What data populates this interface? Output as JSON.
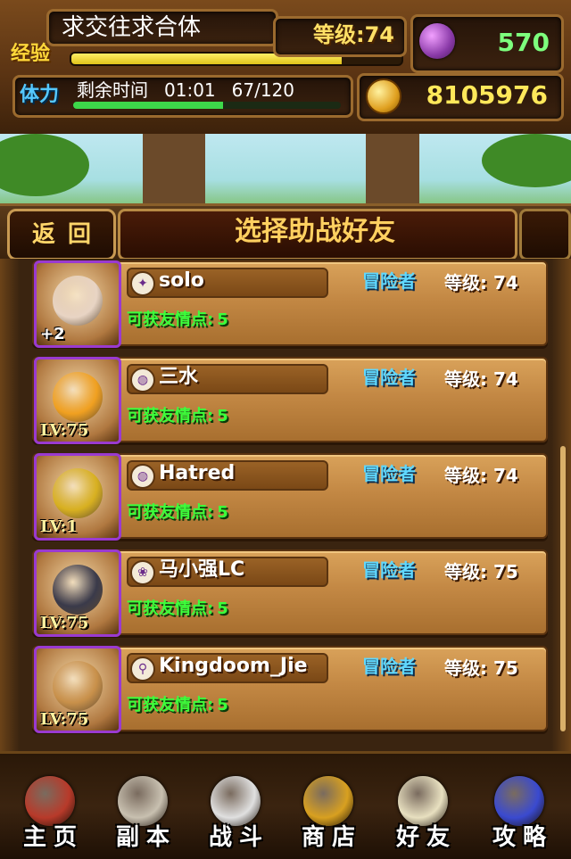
{
  "player": {
    "name": "求交往求合体",
    "exp_label": "经验",
    "exp_fraction": 0.82,
    "level_text": "等级:74",
    "gems": "570",
    "stamina_label": "体力",
    "stamina_time_label": "剩余时间",
    "stamina_time": "01:01",
    "stamina_value": "67/120",
    "stamina_fraction": 0.56,
    "coins": "8105976"
  },
  "titlebar": {
    "back_label": "返回",
    "title": "选择助战好友"
  },
  "friends": [
    {
      "name": "solo",
      "role_icon": "sword-icon",
      "class": "冒险者",
      "level": "等级: 74",
      "points_label": "可获友情点:",
      "points": "5",
      "badge": "+2",
      "avatar_color": "#e8d4c4"
    },
    {
      "name": "三水",
      "role_icon": "shell-icon",
      "class": "冒险者",
      "level": "等级: 74",
      "points_label": "可获友情点:",
      "points": "5",
      "badge": "LV:75",
      "avatar_color": "#f0a020"
    },
    {
      "name": "Hatred",
      "role_icon": "shell-icon",
      "class": "冒险者",
      "level": "等级: 74",
      "points_label": "可获友情点:",
      "points": "5",
      "badge": "LV:1",
      "avatar_color": "#d8b020"
    },
    {
      "name": "马小强LC",
      "role_icon": "paw-icon",
      "class": "冒险者",
      "level": "等级: 75",
      "points_label": "可获友情点:",
      "points": "5",
      "badge": "LV:75",
      "avatar_color": "#3a3a4a"
    },
    {
      "name": "Kingdoom_Jie",
      "role_icon": "staff-icon",
      "class": "冒险者",
      "level": "等级: 75",
      "points_label": "可获友情点:",
      "points": "5",
      "badge": "LV:75",
      "avatar_color": "#c8904a"
    }
  ],
  "nav": [
    {
      "label": "主页",
      "icon": "house-icon",
      "color": "#b83a2a"
    },
    {
      "label": "副本",
      "icon": "skull-icon",
      "color": "#c8c0b0"
    },
    {
      "label": "战斗",
      "icon": "target-icon",
      "color": "#e0e0e0"
    },
    {
      "label": "商店",
      "icon": "crown-icon",
      "color": "#d8a020"
    },
    {
      "label": "好友",
      "icon": "wings-icon",
      "color": "#e8e0c0"
    },
    {
      "label": "攻略",
      "icon": "wizard-hat-icon",
      "color": "#3a4ad0"
    }
  ],
  "colors": {
    "exp_fill": "#e0c21a",
    "stamina_fill": "#3dd84a",
    "gem_value": "#7dff7d",
    "coin_value": "#ffe85a",
    "class_text": "#5fd8ff",
    "points_text": "#3bff3b"
  }
}
